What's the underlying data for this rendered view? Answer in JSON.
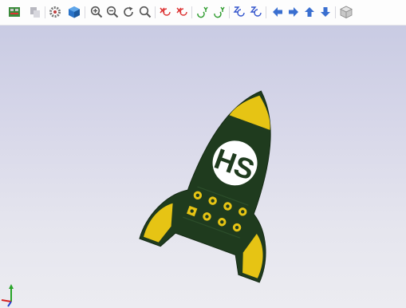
{
  "toolbar": {
    "buttons": [
      {
        "name": "pcb-render-toggle-button",
        "icon": "board-icon"
      },
      {
        "name": "copy-image-button",
        "icon": "copy-icon"
      },
      {
        "name": "settings-button",
        "icon": "gear-icon"
      },
      {
        "name": "raytracing-button",
        "icon": "cube-3d-icon"
      },
      {
        "name": "zoom-in-button",
        "icon": "zoom-in-icon"
      },
      {
        "name": "zoom-out-button",
        "icon": "zoom-out-icon"
      },
      {
        "name": "redraw-button",
        "icon": "refresh-icon"
      },
      {
        "name": "zoom-fit-button",
        "icon": "zoom-fit-icon"
      },
      {
        "name": "rotate-x-cw-button",
        "icon": "rotate-x-icon"
      },
      {
        "name": "rotate-x-ccw-button",
        "icon": "rotate-x-icon"
      },
      {
        "name": "rotate-y-cw-button",
        "icon": "rotate-y-icon"
      },
      {
        "name": "rotate-y-ccw-button",
        "icon": "rotate-y-icon"
      },
      {
        "name": "rotate-z-cw-button",
        "icon": "rotate-z-icon"
      },
      {
        "name": "rotate-z-ccw-button",
        "icon": "rotate-z-icon"
      },
      {
        "name": "pan-left-button",
        "icon": "arrow-left-icon"
      },
      {
        "name": "pan-right-button",
        "icon": "arrow-right-icon"
      },
      {
        "name": "pan-up-button",
        "icon": "arrow-up-icon"
      },
      {
        "name": "pan-down-button",
        "icon": "arrow-down-icon"
      },
      {
        "name": "orthographic-toggle-button",
        "icon": "ortho-cube-icon"
      }
    ]
  },
  "board": {
    "silkscreen_text": "HS",
    "colors": {
      "soldermask": "#1f3b1e",
      "copper": "#e6c414",
      "silkscreen": "#ffffff",
      "background_top": "#c9cbe3",
      "background_bottom": "#ececf1"
    }
  },
  "axes": {
    "colors": {
      "x": "#d42020",
      "y": "#28a428",
      "z": "#2040d0"
    }
  }
}
